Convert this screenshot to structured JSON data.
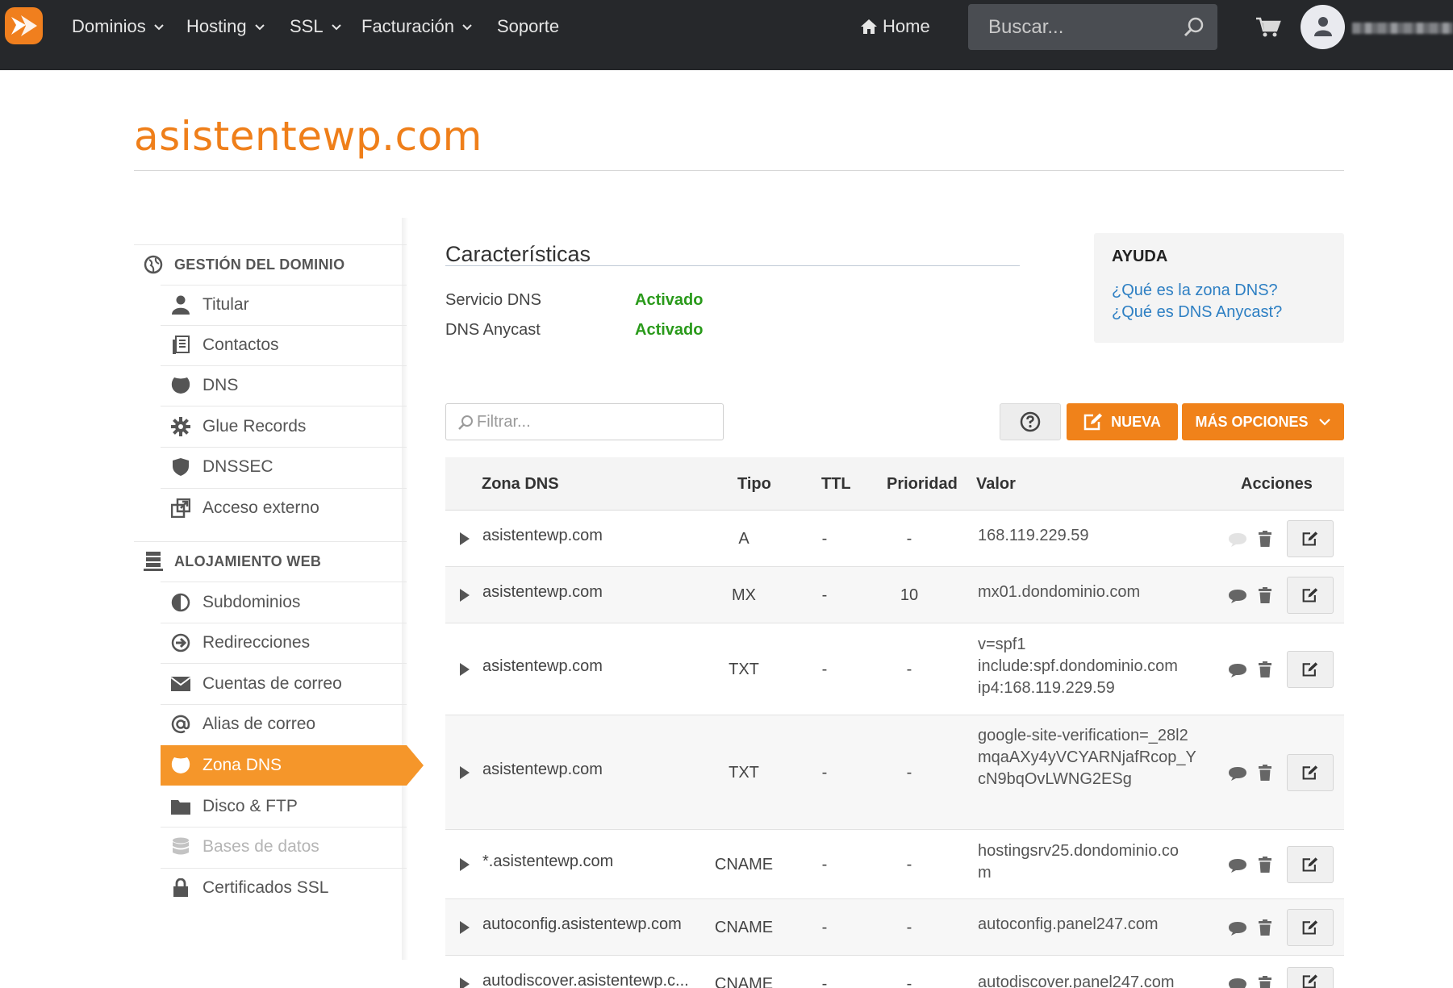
{
  "nav": {
    "items": [
      {
        "label": "Dominios",
        "dropdown": true
      },
      {
        "label": "Hosting",
        "dropdown": true
      },
      {
        "label": "SSL",
        "dropdown": true
      },
      {
        "label": "Facturación",
        "dropdown": true
      },
      {
        "label": "Soporte",
        "dropdown": false
      }
    ],
    "home_label": "Home",
    "search_placeholder": "Buscar..."
  },
  "page": {
    "title": "asistentewp.com"
  },
  "sidebar": {
    "section_domain": "GESTIÓN DEL DOMINIO",
    "domain_items": [
      {
        "label": "Titular",
        "icon": "user-icon"
      },
      {
        "label": "Contactos",
        "icon": "contacts-icon"
      },
      {
        "label": "DNS",
        "icon": "dns-icon"
      },
      {
        "label": "Glue Records",
        "icon": "gear-icon"
      },
      {
        "label": "DNSSEC",
        "icon": "shield-icon"
      },
      {
        "label": "Acceso externo",
        "icon": "external-icon"
      }
    ],
    "section_hosting": "ALOJAMIENTO WEB",
    "hosting_items": [
      {
        "label": "Subdominios",
        "icon": "half-circle-icon",
        "state": "normal"
      },
      {
        "label": "Redirecciones",
        "icon": "arrow-circle-icon",
        "state": "normal"
      },
      {
        "label": "Cuentas de correo",
        "icon": "envelope-icon",
        "state": "normal"
      },
      {
        "label": "Alias de correo",
        "icon": "at-icon",
        "state": "normal"
      },
      {
        "label": "Zona DNS",
        "icon": "dns-icon",
        "state": "active"
      },
      {
        "label": "Disco & FTP",
        "icon": "folder-icon",
        "state": "normal"
      },
      {
        "label": "Bases de datos",
        "icon": "database-icon",
        "state": "disabled"
      },
      {
        "label": "Certificados SSL",
        "icon": "lock-icon",
        "state": "normal"
      }
    ]
  },
  "features": {
    "title": "Características",
    "rows": [
      {
        "label": "Servicio DNS",
        "value": "Activado"
      },
      {
        "label": "DNS Anycast",
        "value": "Activado"
      }
    ]
  },
  "help": {
    "title": "AYUDA",
    "links": [
      "¿Qué es la zona DNS?",
      "¿Qué es DNS Anycast?"
    ]
  },
  "toolbar": {
    "filter_placeholder": "Filtrar...",
    "new_label": "NUEVA",
    "more_label": "MÁS OPCIONES"
  },
  "table": {
    "headers": {
      "zona": "Zona DNS",
      "tipo": "Tipo",
      "ttl": "TTL",
      "prioridad": "Prioridad",
      "valor": "Valor",
      "acciones": "Acciones"
    },
    "rows": [
      {
        "zona": "asistentewp.com",
        "tipo": "A",
        "ttl": "-",
        "prioridad": "-",
        "valor": "168.119.229.59",
        "comment_active": false
      },
      {
        "zona": "asistentewp.com",
        "tipo": "MX",
        "ttl": "-",
        "prioridad": "10",
        "valor": "mx01.dondominio.com",
        "comment_active": true
      },
      {
        "zona": "asistentewp.com",
        "tipo": "TXT",
        "ttl": "-",
        "prioridad": "-",
        "valor": "v=spf1 include:spf.dondominio.com ip4:168.119.229.59",
        "comment_active": true
      },
      {
        "zona": "asistentewp.com",
        "tipo": "TXT",
        "ttl": "-",
        "prioridad": "-",
        "valor": "google-site-verification=_28l2mqaAXy4yVCYARNjafRcop_YcN9bqOvLWNG2ESg",
        "comment_active": true
      },
      {
        "zona": "*.asistentewp.com",
        "tipo": "CNAME",
        "ttl": "-",
        "prioridad": "-",
        "valor": "hostingsrv25.dondominio.com",
        "comment_active": true
      },
      {
        "zona": "autoconfig.asistentewp.com",
        "tipo": "CNAME",
        "ttl": "-",
        "prioridad": "-",
        "valor": "autoconfig.panel247.com",
        "comment_active": true
      },
      {
        "zona": "autodiscover.asistentewp.c...",
        "tipo": "CNAME",
        "ttl": "-",
        "prioridad": "-",
        "valor": "autodiscover.panel247.com",
        "comment_active": true
      }
    ]
  },
  "colors": {
    "brand": "#f0821a",
    "active_sidebar": "#f5962a",
    "ok": "#2a9a1b",
    "link": "#2d7fc3",
    "nav_bg": "#26282b"
  }
}
